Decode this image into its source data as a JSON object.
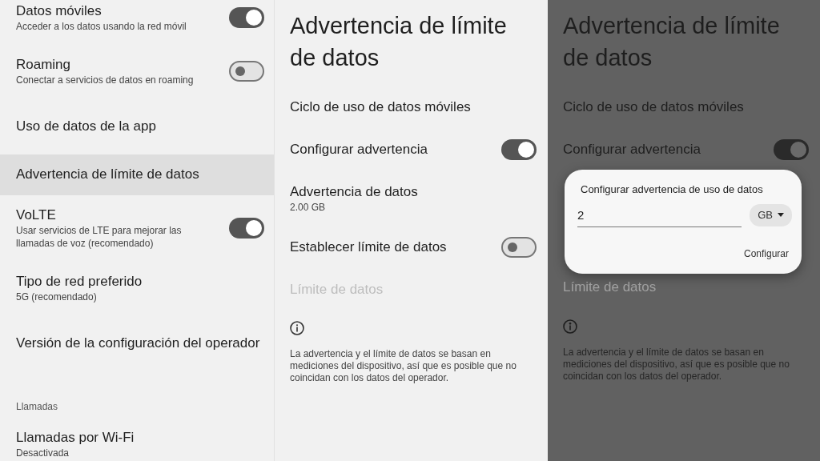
{
  "left": {
    "items": [
      {
        "kind": "toggle",
        "title": "Datos móviles",
        "subtitle": "Acceder a los datos usando la red móvil",
        "on": true,
        "selected": false
      },
      {
        "kind": "toggle",
        "title": "Roaming",
        "subtitle": "Conectar a servicios de datos en roaming",
        "on": false,
        "selected": false
      },
      {
        "kind": "link",
        "title": "Uso de datos de la app",
        "selected": false
      },
      {
        "kind": "link",
        "title": "Advertencia de límite de datos",
        "selected": true
      },
      {
        "kind": "toggle",
        "title": "VoLTE",
        "subtitle": "Usar servicios de LTE para mejorar las llamadas de voz (recomendado)",
        "on": true,
        "selected": false
      },
      {
        "kind": "link",
        "title": "Tipo de red preferido",
        "subtitle": "5G (recomendado)",
        "selected": false
      },
      {
        "kind": "link",
        "title": "Versión de la configuración del operador",
        "selected": false
      },
      {
        "kind": "header",
        "title": "Llamadas"
      },
      {
        "kind": "link",
        "title": "Llamadas por Wi-Fi",
        "subtitle": "Desactivada",
        "selected": false
      }
    ]
  },
  "screens": [
    {
      "dimmed": false,
      "title": "Advertencia de límite de datos",
      "rows": [
        {
          "kind": "link",
          "title": "Ciclo de uso de datos móviles",
          "disabled": false
        },
        {
          "kind": "toggle",
          "title": "Configurar advertencia",
          "on": true,
          "disabled": false
        },
        {
          "kind": "link",
          "title": "Advertencia de datos",
          "subtitle": "2.00 GB",
          "disabled": false
        },
        {
          "kind": "toggle",
          "title": "Establecer límite de datos",
          "on": false,
          "disabled": false
        },
        {
          "kind": "link",
          "title": "Límite de datos",
          "disabled": true
        }
      ],
      "note": "La advertencia y el límite de datos se basan en mediciones del dispositivo, así que es posible que no coincidan con los datos del operador."
    },
    {
      "dimmed": true,
      "title": "Advertencia de límite de datos",
      "rows": [
        {
          "kind": "link",
          "title": "Ciclo de uso de datos móviles",
          "disabled": false
        },
        {
          "kind": "toggle",
          "title": "Configurar advertencia",
          "on": true,
          "disabled": false
        },
        {
          "kind": "dialog",
          "title": "Configurar advertencia de uso de datos",
          "value": "2",
          "unit": "GB",
          "button": "Configurar"
        },
        {
          "kind": "link",
          "title": "Límite de datos",
          "disabled": true
        }
      ],
      "note": "La advertencia y el límite de datos se basan en mediciones del dispositivo, así que es posible que no coincidan con los datos del operador."
    }
  ]
}
